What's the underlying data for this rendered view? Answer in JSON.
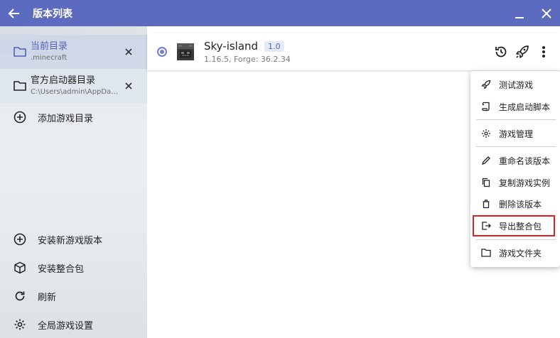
{
  "titlebar": {
    "title": "版本列表",
    "bg_color": "#5c6bc0"
  },
  "directories": [
    {
      "name": "当前目录",
      "path": ".minecraft",
      "selected": true
    },
    {
      "name": "官方启动器目录",
      "path": "C:\\Users\\admin\\AppDat...",
      "selected": false
    }
  ],
  "sidebar_actions": {
    "add_dir": "添加游戏目录",
    "install_version": "安装新游戏版本",
    "install_modpack": "安装整合包",
    "refresh": "刷新",
    "global_settings": "全局游戏设置"
  },
  "version": {
    "name": "Sky-island",
    "tag": "1.0",
    "subtitle": "1.16.5, Forge: 36.2.34"
  },
  "menu": {
    "test_game": "测试游戏",
    "gen_script": "生成启动脚本",
    "game_manage": "游戏管理",
    "rename": "重命名该版本",
    "duplicate": "复制游戏实例",
    "delete": "删除该版本",
    "export_modpack": "导出整合包",
    "game_folder": "游戏文件夹"
  },
  "colors": {
    "accent": "#5c6bc0",
    "highlight_border": "#e02020"
  }
}
